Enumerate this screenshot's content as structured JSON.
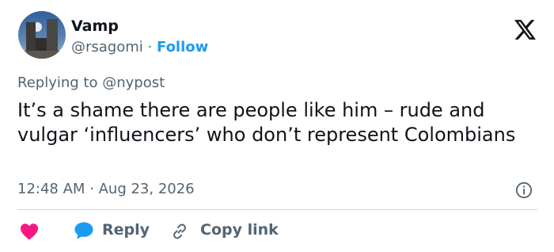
{
  "author": {
    "name": "Vamp",
    "handle": "@rsagomi",
    "separator": "·",
    "follow_label": "Follow"
  },
  "reply_context": {
    "prefix": "Replying to",
    "mention": "@nypost"
  },
  "tweet": {
    "text": "It’s a shame there are people like him – rude and vulgar ‘influencers’ who don’t represent Colombians",
    "timestamp": "12:48 AM · Aug 23, 2026"
  },
  "actions": {
    "reply_label": "Reply",
    "copy_link_label": "Copy link"
  },
  "icons": {
    "brand": "x-logo-icon",
    "info": "info-icon",
    "like": "heart-icon",
    "reply": "reply-bubble-icon",
    "copy": "link-icon"
  },
  "colors": {
    "accent": "#1d9bf0",
    "heart": "#f91880",
    "muted": "#536471",
    "text": "#0f1419"
  }
}
